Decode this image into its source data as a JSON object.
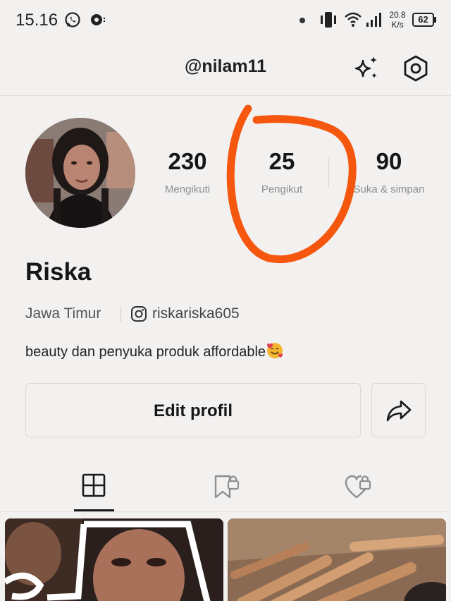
{
  "status_bar": {
    "time": "15.16",
    "speed_value": "20.8",
    "speed_unit": "K/s",
    "battery": "62",
    "icons": [
      "whatsapp-icon",
      "app-notification-icon",
      "dot-icon",
      "vibrate-icon",
      "wifi-icon",
      "signal-icon",
      "battery-icon"
    ]
  },
  "header": {
    "username": "@nilam11",
    "icons": [
      "sparkle-icon",
      "settings-icon"
    ]
  },
  "profile": {
    "display_name": "Riska",
    "location": "Jawa Timur",
    "instagram": "riskariska605",
    "bio": "beauty dan penyuka produk affordable"
  },
  "stats": [
    {
      "value": "230",
      "label": "Mengikuti"
    },
    {
      "value": "25",
      "label": "Pengikut"
    },
    {
      "value": "90",
      "label": "Suka & simpan"
    }
  ],
  "actions": {
    "edit_label": "Edit profil",
    "share_icon": "share-icon"
  },
  "tabs": [
    {
      "icon": "grid-icon",
      "active": true
    },
    {
      "icon": "saved-locked-icon",
      "active": false
    },
    {
      "icon": "liked-locked-icon",
      "active": false
    }
  ],
  "colors": {
    "background": "#f3f1f0",
    "annotation": "#f5570f",
    "text": "#161616",
    "muted": "#8d8d8d"
  }
}
